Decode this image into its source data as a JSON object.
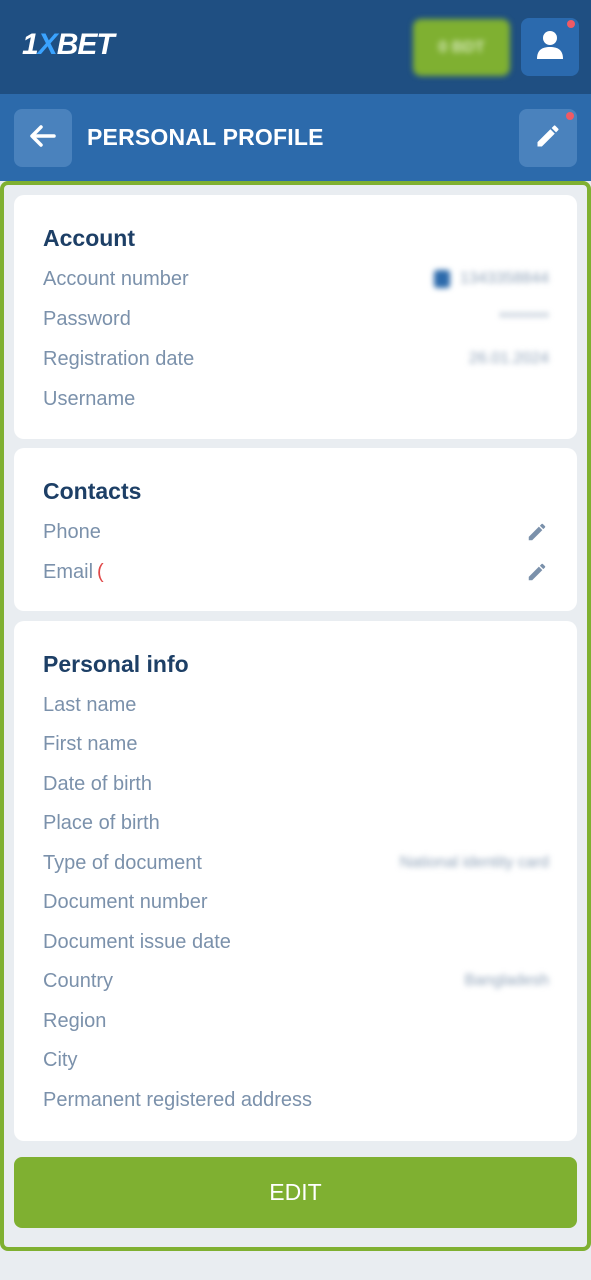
{
  "top_bar": {
    "logo_prefix": "1",
    "logo_x": "X",
    "logo_suffix": "BET",
    "balance_label": "0 BDT",
    "icons": [
      "user-icon"
    ]
  },
  "header": {
    "title": "PERSONAL PROFILE",
    "icons": [
      "arrow-left-icon",
      "pencil-icon"
    ]
  },
  "account": {
    "title": "Account",
    "rows": [
      {
        "label": "Account number",
        "value": "1343358844"
      },
      {
        "label": "Password",
        "value": "********"
      },
      {
        "label": "Registration date",
        "value": "26.01.2024"
      },
      {
        "label": "Username",
        "value": ""
      }
    ]
  },
  "contacts": {
    "title": "Contacts",
    "rows": [
      {
        "label": "Phone"
      },
      {
        "label": "Email"
      }
    ]
  },
  "personal_info": {
    "title": "Personal info",
    "rows": [
      {
        "label": "Last name",
        "value": ""
      },
      {
        "label": "First name",
        "value": ""
      },
      {
        "label": "Date of birth",
        "value": ""
      },
      {
        "label": "Place of birth",
        "value": ""
      },
      {
        "label": "Type of document",
        "value": "National identity card"
      },
      {
        "label": "Document number",
        "value": ""
      },
      {
        "label": "Document issue date",
        "value": ""
      },
      {
        "label": "Country",
        "value": "Bangladesh"
      },
      {
        "label": "Region",
        "value": ""
      },
      {
        "label": "City",
        "value": ""
      },
      {
        "label": "Permanent registered address",
        "value": ""
      }
    ]
  },
  "edit_button": {
    "label": "EDIT"
  },
  "colors": {
    "topbar": "#1f4f82",
    "headbar": "#2c6aab",
    "accent_green": "#7fb031",
    "title_text": "#1d3f66",
    "label_text": "#7b91ab"
  }
}
